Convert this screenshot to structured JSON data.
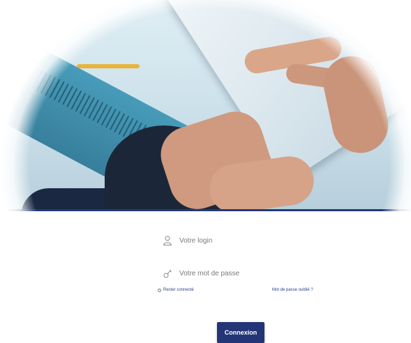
{
  "login_form": {
    "login_placeholder": "Votre login",
    "password_placeholder": "Votre mot de passe",
    "remember_label": "Rester connecté",
    "forgot_label": "Mot de passe oublié ?",
    "submit_label": "Connexion"
  },
  "icons": {
    "login": "user-icon",
    "password": "key-icon"
  },
  "colors": {
    "brand": "#233577",
    "link": "#2c3e8a",
    "divider": "#223a78"
  }
}
